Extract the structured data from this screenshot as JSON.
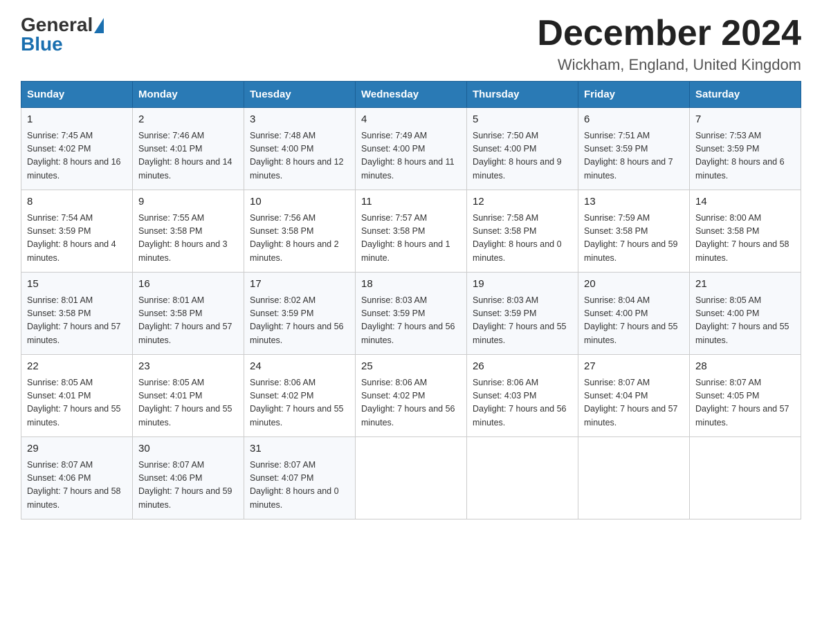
{
  "logo": {
    "general": "General",
    "blue": "Blue"
  },
  "title": "December 2024",
  "location": "Wickham, England, United Kingdom",
  "days_of_week": [
    "Sunday",
    "Monday",
    "Tuesday",
    "Wednesday",
    "Thursday",
    "Friday",
    "Saturday"
  ],
  "weeks": [
    [
      {
        "day": "1",
        "sunrise": "7:45 AM",
        "sunset": "4:02 PM",
        "daylight": "8 hours and 16 minutes."
      },
      {
        "day": "2",
        "sunrise": "7:46 AM",
        "sunset": "4:01 PM",
        "daylight": "8 hours and 14 minutes."
      },
      {
        "day": "3",
        "sunrise": "7:48 AM",
        "sunset": "4:00 PM",
        "daylight": "8 hours and 12 minutes."
      },
      {
        "day": "4",
        "sunrise": "7:49 AM",
        "sunset": "4:00 PM",
        "daylight": "8 hours and 11 minutes."
      },
      {
        "day": "5",
        "sunrise": "7:50 AM",
        "sunset": "4:00 PM",
        "daylight": "8 hours and 9 minutes."
      },
      {
        "day": "6",
        "sunrise": "7:51 AM",
        "sunset": "3:59 PM",
        "daylight": "8 hours and 7 minutes."
      },
      {
        "day": "7",
        "sunrise": "7:53 AM",
        "sunset": "3:59 PM",
        "daylight": "8 hours and 6 minutes."
      }
    ],
    [
      {
        "day": "8",
        "sunrise": "7:54 AM",
        "sunset": "3:59 PM",
        "daylight": "8 hours and 4 minutes."
      },
      {
        "day": "9",
        "sunrise": "7:55 AM",
        "sunset": "3:58 PM",
        "daylight": "8 hours and 3 minutes."
      },
      {
        "day": "10",
        "sunrise": "7:56 AM",
        "sunset": "3:58 PM",
        "daylight": "8 hours and 2 minutes."
      },
      {
        "day": "11",
        "sunrise": "7:57 AM",
        "sunset": "3:58 PM",
        "daylight": "8 hours and 1 minute."
      },
      {
        "day": "12",
        "sunrise": "7:58 AM",
        "sunset": "3:58 PM",
        "daylight": "8 hours and 0 minutes."
      },
      {
        "day": "13",
        "sunrise": "7:59 AM",
        "sunset": "3:58 PM",
        "daylight": "7 hours and 59 minutes."
      },
      {
        "day": "14",
        "sunrise": "8:00 AM",
        "sunset": "3:58 PM",
        "daylight": "7 hours and 58 minutes."
      }
    ],
    [
      {
        "day": "15",
        "sunrise": "8:01 AM",
        "sunset": "3:58 PM",
        "daylight": "7 hours and 57 minutes."
      },
      {
        "day": "16",
        "sunrise": "8:01 AM",
        "sunset": "3:58 PM",
        "daylight": "7 hours and 57 minutes."
      },
      {
        "day": "17",
        "sunrise": "8:02 AM",
        "sunset": "3:59 PM",
        "daylight": "7 hours and 56 minutes."
      },
      {
        "day": "18",
        "sunrise": "8:03 AM",
        "sunset": "3:59 PM",
        "daylight": "7 hours and 56 minutes."
      },
      {
        "day": "19",
        "sunrise": "8:03 AM",
        "sunset": "3:59 PM",
        "daylight": "7 hours and 55 minutes."
      },
      {
        "day": "20",
        "sunrise": "8:04 AM",
        "sunset": "4:00 PM",
        "daylight": "7 hours and 55 minutes."
      },
      {
        "day": "21",
        "sunrise": "8:05 AM",
        "sunset": "4:00 PM",
        "daylight": "7 hours and 55 minutes."
      }
    ],
    [
      {
        "day": "22",
        "sunrise": "8:05 AM",
        "sunset": "4:01 PM",
        "daylight": "7 hours and 55 minutes."
      },
      {
        "day": "23",
        "sunrise": "8:05 AM",
        "sunset": "4:01 PM",
        "daylight": "7 hours and 55 minutes."
      },
      {
        "day": "24",
        "sunrise": "8:06 AM",
        "sunset": "4:02 PM",
        "daylight": "7 hours and 55 minutes."
      },
      {
        "day": "25",
        "sunrise": "8:06 AM",
        "sunset": "4:02 PM",
        "daylight": "7 hours and 56 minutes."
      },
      {
        "day": "26",
        "sunrise": "8:06 AM",
        "sunset": "4:03 PM",
        "daylight": "7 hours and 56 minutes."
      },
      {
        "day": "27",
        "sunrise": "8:07 AM",
        "sunset": "4:04 PM",
        "daylight": "7 hours and 57 minutes."
      },
      {
        "day": "28",
        "sunrise": "8:07 AM",
        "sunset": "4:05 PM",
        "daylight": "7 hours and 57 minutes."
      }
    ],
    [
      {
        "day": "29",
        "sunrise": "8:07 AM",
        "sunset": "4:06 PM",
        "daylight": "7 hours and 58 minutes."
      },
      {
        "day": "30",
        "sunrise": "8:07 AM",
        "sunset": "4:06 PM",
        "daylight": "7 hours and 59 minutes."
      },
      {
        "day": "31",
        "sunrise": "8:07 AM",
        "sunset": "4:07 PM",
        "daylight": "8 hours and 0 minutes."
      },
      null,
      null,
      null,
      null
    ]
  ],
  "labels": {
    "sunrise": "Sunrise:",
    "sunset": "Sunset:",
    "daylight": "Daylight:"
  }
}
